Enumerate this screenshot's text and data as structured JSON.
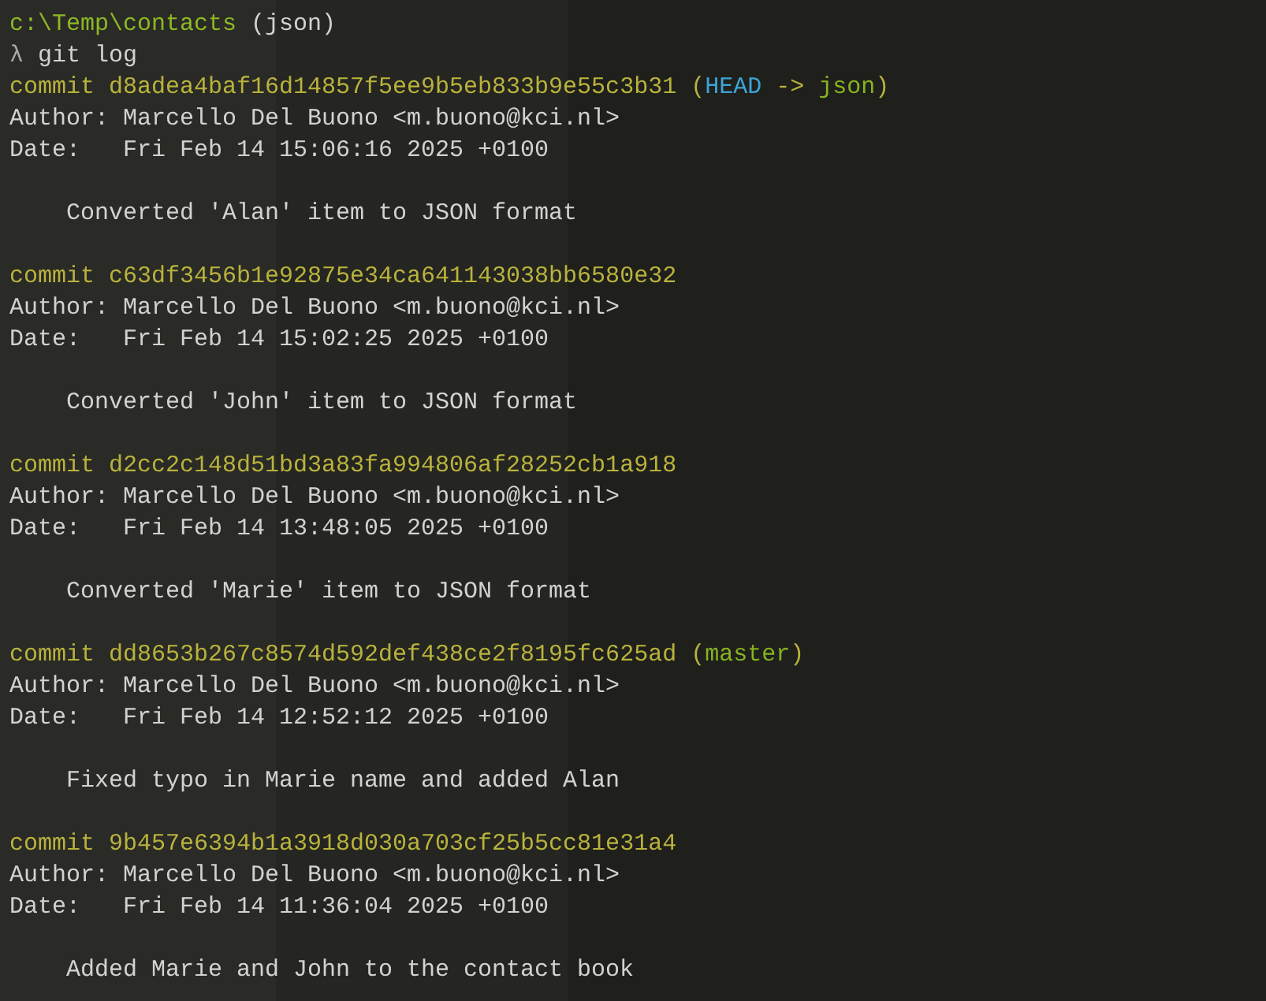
{
  "prompt": {
    "path": "c:\\Temp\\contacts",
    "branch": "(json)"
  },
  "command": {
    "symbol": "λ",
    "text": "git log"
  },
  "commits": [
    {
      "commit": "commit d8adea4baf16d14857f5ee9b5eb833b9e55c3b31",
      "decoration": [
        {
          "text": "(",
          "kind": "punct"
        },
        {
          "text": "HEAD",
          "kind": "head"
        },
        {
          "text": " -> ",
          "kind": "punct"
        },
        {
          "text": "json",
          "kind": "branch"
        },
        {
          "text": ")",
          "kind": "punct"
        }
      ],
      "author": "Author: Marcello Del Buono <m.buono@kci.nl>",
      "date": "Date:   Fri Feb 14 15:06:16 2025 +0100",
      "message": "Converted 'Alan' item to JSON format"
    },
    {
      "commit": "commit c63df3456b1e92875e34ca641143038bb6580e32",
      "author": "Author: Marcello Del Buono <m.buono@kci.nl>",
      "date": "Date:   Fri Feb 14 15:02:25 2025 +0100",
      "message": "Converted 'John' item to JSON format"
    },
    {
      "commit": "commit d2cc2c148d51bd3a83fa994806af28252cb1a918",
      "author": "Author: Marcello Del Buono <m.buono@kci.nl>",
      "date": "Date:   Fri Feb 14 13:48:05 2025 +0100",
      "message": "Converted 'Marie' item to JSON format"
    },
    {
      "commit": "commit dd8653b267c8574d592def438ce2f8195fc625ad",
      "decoration": [
        {
          "text": "(",
          "kind": "punct"
        },
        {
          "text": "master",
          "kind": "branch"
        },
        {
          "text": ")",
          "kind": "punct"
        }
      ],
      "author": "Author: Marcello Del Buono <m.buono@kci.nl>",
      "date": "Date:   Fri Feb 14 12:52:12 2025 +0100",
      "message": "Fixed typo in Marie name and added Alan"
    },
    {
      "commit": "commit 9b457e6394b1a3918d030a703cf25b5cc81e31a4",
      "author": "Author: Marcello Del Buono <m.buono@kci.nl>",
      "date": "Date:   Fri Feb 14 11:36:04 2025 +0100",
      "message": "Added Marie and John to the contact book"
    }
  ]
}
